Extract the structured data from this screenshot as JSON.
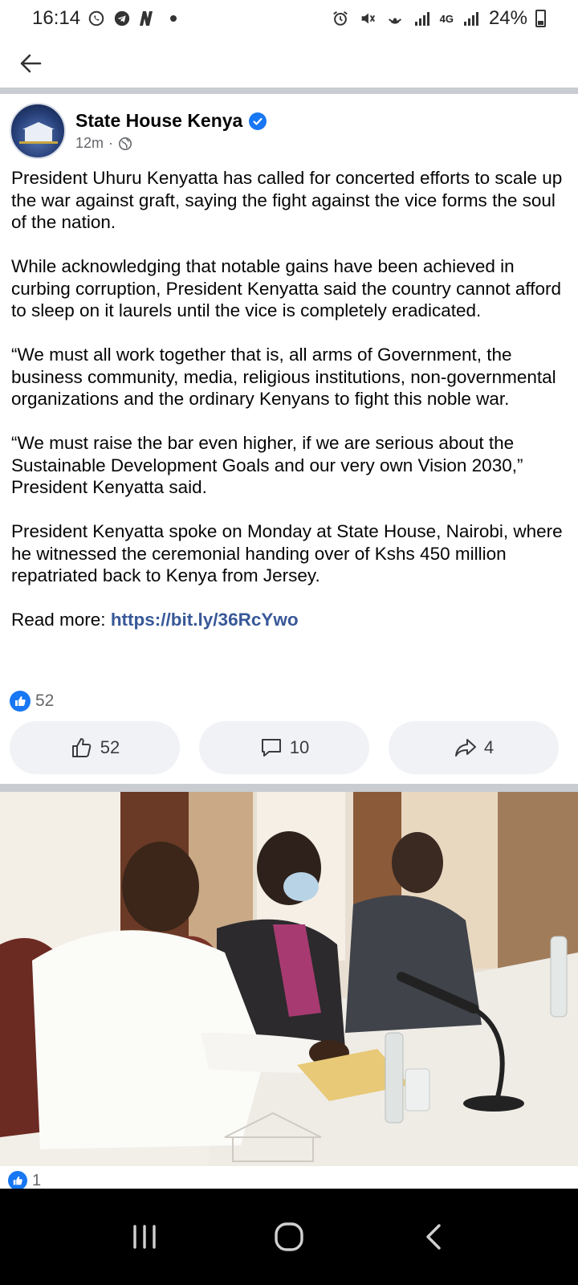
{
  "status_bar": {
    "time": "16:14",
    "battery": "24%",
    "network": "4G"
  },
  "post": {
    "page_name": "State House Kenya",
    "time_ago": "12m",
    "separator": "·",
    "paragraphs": [
      "President Uhuru Kenyatta has called for concerted efforts to scale up the war against graft, saying the fight against the vice forms the soul of the nation.",
      "While acknowledging that notable gains have been achieved in curbing corruption, President Kenyatta said the country cannot afford to sleep on it laurels until the vice is completely eradicated.",
      "“We must all work together that is, all arms of Government, the business community, media, religious institutions, non-governmental organizations and the ordinary Kenyans to fight this noble war.",
      "“We must raise the bar even higher, if we are serious about the Sustainable Development Goals and our very own Vision 2030,” President Kenyatta said.",
      "President Kenyatta spoke on Monday at State House, Nairobi, where he witnessed the ceremonial handing over of Kshs 450 million repatriated back to Kenya from Jersey."
    ],
    "read_more_label": "Read more: ",
    "read_more_link": "https://bit.ly/36RcYwo",
    "reaction_count": "52",
    "actions": {
      "like_count": "52",
      "comment_count": "10",
      "share_count": "4"
    }
  },
  "photo": {
    "reaction_count": "1"
  },
  "colors": {
    "brand_blue": "#1877f2",
    "link_blue": "#385898",
    "button_bg": "#f0f2f5",
    "divider": "#c9ccd1"
  }
}
